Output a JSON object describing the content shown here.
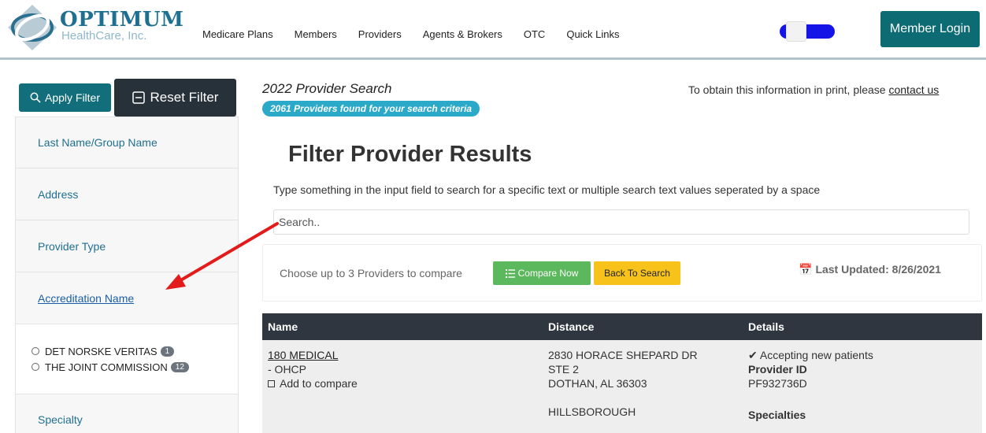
{
  "header": {
    "logo_main": "OPTIMUM",
    "logo_sub": "HealthCare, Inc.",
    "nav": [
      "Medicare Plans",
      "Members",
      "Providers",
      "Agents & Brokers",
      "OTC",
      "Quick Links"
    ],
    "member_login": "Member Login"
  },
  "sidebar": {
    "apply_filter": "Apply Filter",
    "reset_filter": "Reset Filter",
    "items": [
      "Last Name/Group Name",
      "Address",
      "Provider Type",
      "Accreditation Name"
    ],
    "options": [
      {
        "label": "DET NORSKE VERITAS",
        "count": "1"
      },
      {
        "label": "THE JOINT COMMISSION",
        "count": "12"
      }
    ],
    "specialty": "Specialty"
  },
  "main": {
    "title": "2022 Provider Search",
    "count_text": "2061 Providers found for your search criteria",
    "print_prefix": "To obtain this information in print, please ",
    "print_link": "contact us",
    "filter_heading": "Filter Provider Results",
    "instruction": "Type something in the input field to search for a specific text or multiple search text values seperated by a space",
    "search_placeholder": "Search..",
    "compare_text": "Choose up to 3 Providers to compare",
    "compare_btn": "Compare Now",
    "back_btn": "Back To Search",
    "last_updated": "Last Updated: 8/26/2021"
  },
  "table": {
    "headers": [
      "Name",
      "Distance",
      "Details"
    ],
    "row": {
      "name": "180 MEDICAL",
      "suffix": "- OHCP",
      "add_compare": "Add to compare",
      "address": [
        "2830 HORACE SHEPARD DR",
        "STE 2",
        "DOTHAN, AL 36303",
        "",
        "HILLSBOROUGH"
      ],
      "accepting": "Accepting new patients",
      "provider_id_label": "Provider ID",
      "provider_id": "PF932736D",
      "specialties_label": "Specialties"
    }
  },
  "colors": {
    "brand_teal": "#116e7a",
    "dark": "#27313a",
    "accent_blue": "#2aa9c9",
    "compare_green": "#5cb85c",
    "back_yellow": "#f7c31a",
    "arrow_red": "#e31b1b"
  }
}
